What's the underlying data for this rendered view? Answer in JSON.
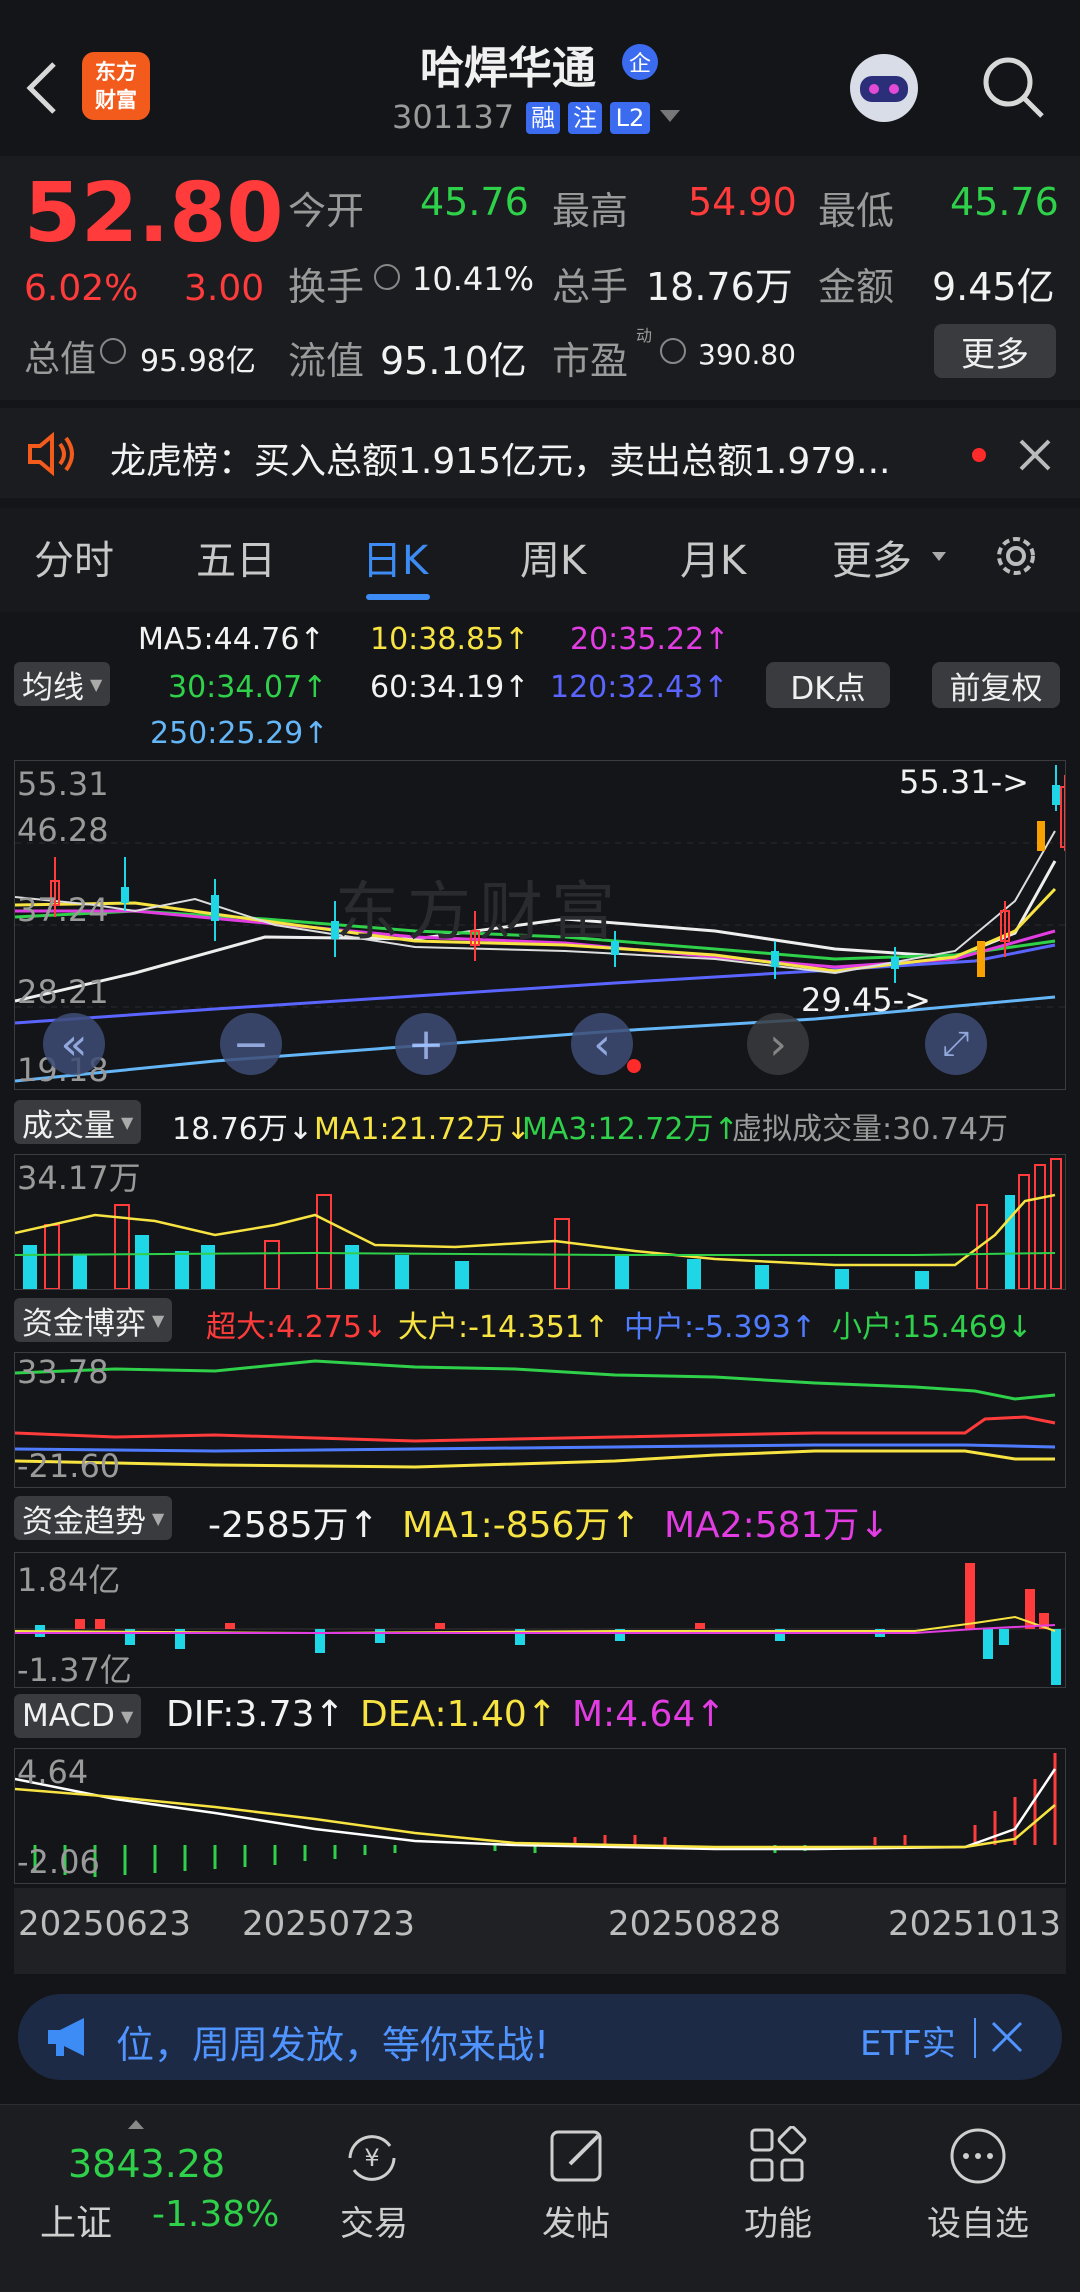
{
  "header": {
    "app_logo": "东方\n财富",
    "stock_name": "哈焊华通",
    "name_badge": "企",
    "stock_code": "301137",
    "tags": [
      "融",
      "注",
      "L2"
    ]
  },
  "quote": {
    "price": "52.80",
    "change_pct": "6.02%",
    "change": "3.00",
    "open_label": "今开",
    "open": "45.76",
    "high_label": "最高",
    "high": "54.90",
    "low_label": "最低",
    "low": "45.76",
    "turnover_label": "换手",
    "turnover": "10.41%",
    "volume_label": "总手",
    "volume": "18.76万",
    "amount_label": "金额",
    "amount": "9.45亿",
    "mktcap_label": "总值",
    "mktcap": "95.98亿",
    "float_label": "流值",
    "float_cap": "95.10亿",
    "pe_label": "市盈",
    "pe_sup": "动",
    "pe": "390.80",
    "more_label": "更多"
  },
  "notice": {
    "text": "龙虎榜：买入总额1.915亿元，卖出总额1.979..."
  },
  "tabs": [
    "分时",
    "五日",
    "日K",
    "周K",
    "月K",
    "更多"
  ],
  "ma_legend": {
    "ma5": "MA5:44.76↑",
    "ma10": "10:38.85↑",
    "ma20": "20:35.22↑",
    "ma30": "30:34.07↑",
    "ma60": "60:34.19↑",
    "ma120": "120:32.43↑",
    "ma250": "250:25.29↑",
    "selector": "均线",
    "dk": "DK点",
    "fq": "前复权"
  },
  "kline": {
    "y_labels": [
      "55.31",
      "46.28",
      "37.24",
      "28.21",
      "19.18"
    ],
    "max_marker": "55.31->",
    "min_marker": "29.45->",
    "watermark": "东方财富"
  },
  "volume": {
    "selector": "成交量",
    "val": "18.76万↓",
    "ma1": "MA1:21.72万↓",
    "ma3": "MA3:12.72万↑",
    "virtual": "虚拟成交量:30.74万",
    "y_label": "34.17万"
  },
  "fund_game": {
    "selector": "资金博弈",
    "super": "超大:4.275↓",
    "large": "大户:-14.351↑",
    "medium": "中户:-5.393↑",
    "small": "小户:15.469↓",
    "y_top": "33.78",
    "y_bottom": "-21.60"
  },
  "fund_trend": {
    "selector": "资金趋势",
    "val": "-2585万↑",
    "ma1": "MA1:-856万↑",
    "ma2": "MA2:581万↓",
    "y_top": "1.84亿",
    "y_bottom": "-1.37亿"
  },
  "macd": {
    "selector": "MACD",
    "dif": "DIF:3.73↑",
    "dea": "DEA:1.40↑",
    "m": "M:4.64↑",
    "y_top": "4.64",
    "y_bottom": "-2.06"
  },
  "dates": [
    "20250623",
    "20250723",
    "20250828",
    "20251013"
  ],
  "banner": {
    "text": "位，周周发放，等你来战!",
    "right": "ETF实"
  },
  "bottom_nav": {
    "index_value": "3843.28",
    "index_name": "上证",
    "index_change": "-1.38%",
    "items": [
      "交易",
      "发帖",
      "功能",
      "设自选"
    ]
  }
}
